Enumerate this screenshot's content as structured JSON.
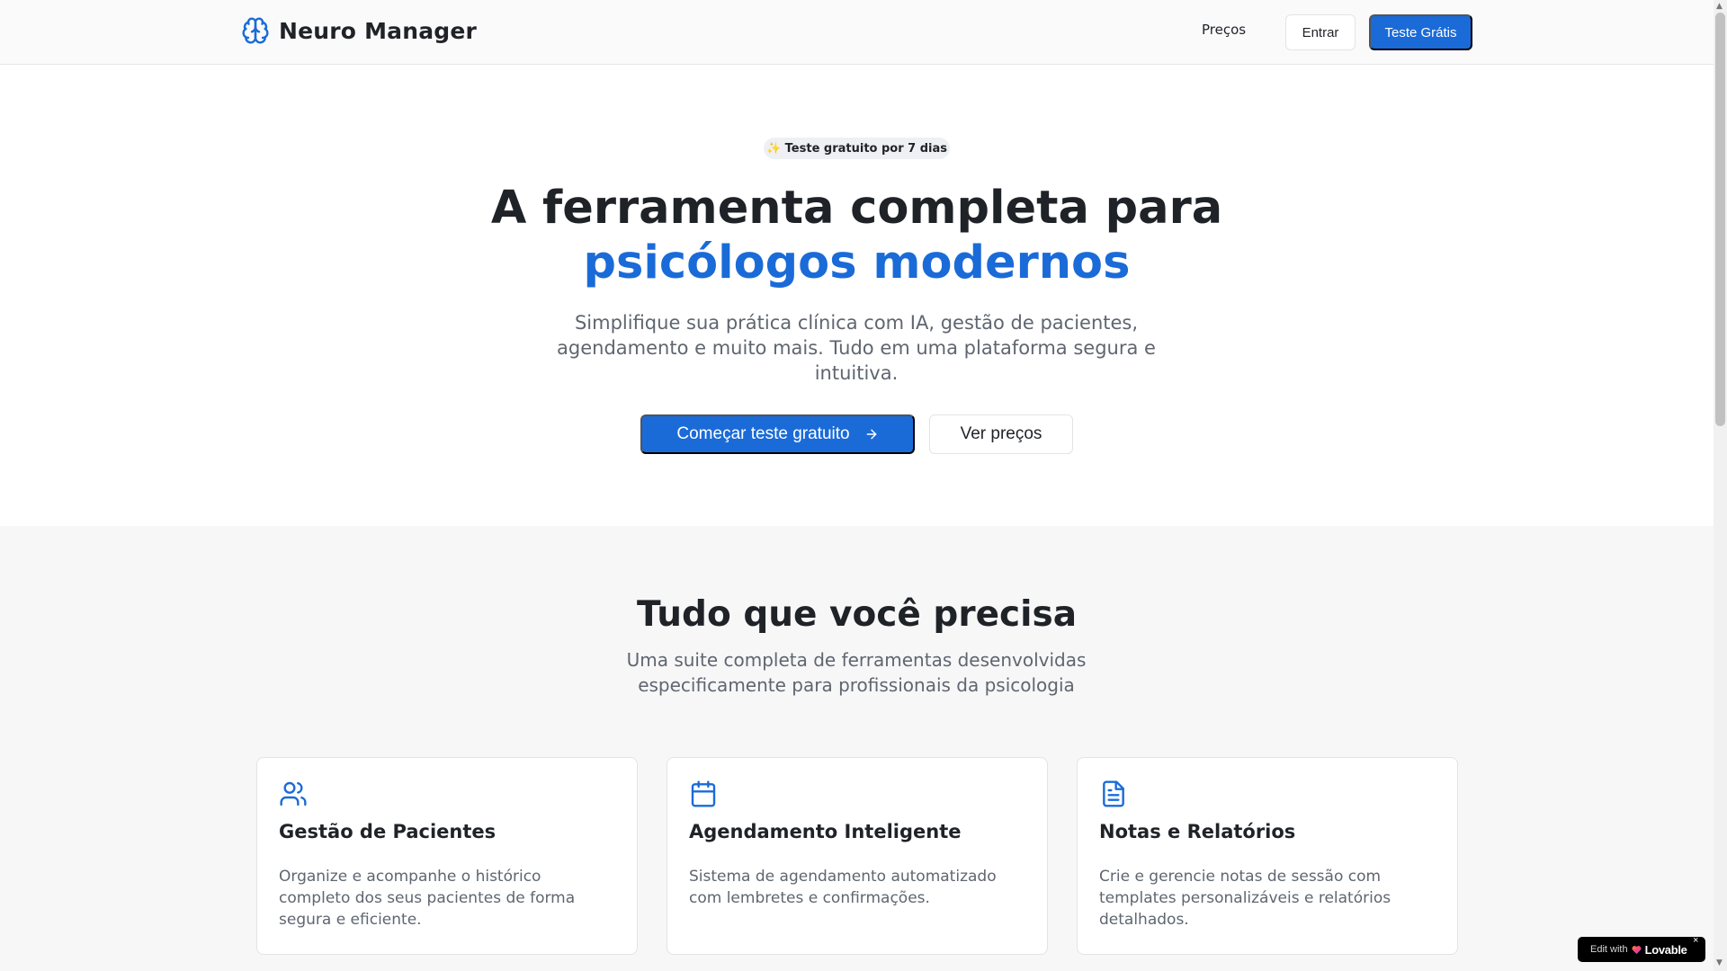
{
  "header": {
    "brand_name": "Neuro Manager",
    "brand_icon": "brain-icon",
    "nav_prices": "Preços",
    "login": "Entrar",
    "trial": "Teste Grátis"
  },
  "hero": {
    "badge": "✨ Teste gratuito por 7 dias",
    "title_line1": "A ferramenta completa para",
    "title_line2": "psicólogos modernos",
    "subtitle": "Simplifique sua prática clínica com IA, gestão de pacientes, agendamento e muito mais. Tudo em uma plataforma segura e intuitiva.",
    "cta_primary": "Começar teste gratuito",
    "cta_primary_icon": "arrow-right-icon",
    "cta_secondary": "Ver preços"
  },
  "features": {
    "title": "Tudo que você precisa",
    "subtitle": "Uma suite completa de ferramentas desenvolvidas especificamente para profissionais da psicologia",
    "cards": [
      {
        "icon": "users-icon",
        "title": "Gestão de Pacientes",
        "description": "Organize e acompanhe o histórico completo dos seus pacientes de forma segura e eficiente."
      },
      {
        "icon": "calendar-icon",
        "title": "Agendamento Inteligente",
        "description": "Sistema de agendamento automatizado com lembretes e confirmações."
      },
      {
        "icon": "file-text-icon",
        "title": "Notas e Relatórios",
        "description": "Crie e gerencie notas de sessão com templates personalizáveis e relatórios detalhados."
      }
    ]
  },
  "lovable_badge": {
    "edit_text": "Edit with",
    "brand": "Lovable",
    "close": "×"
  },
  "colors": {
    "accent": "#1a6bd8",
    "text": "#1f2328",
    "muted": "#5f6670",
    "section_bg": "#f7f7f8"
  }
}
